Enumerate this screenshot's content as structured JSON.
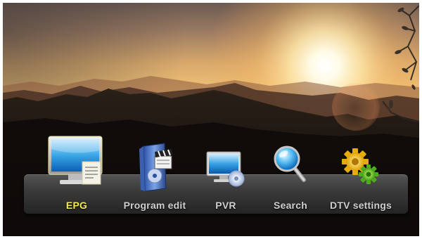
{
  "menu": {
    "selected_index": 0,
    "selected_color": "#f2e94a",
    "label_color": "#cfcfcf",
    "items": [
      {
        "label": "EPG",
        "icon": "tv-monitor-icon",
        "selected": true
      },
      {
        "label": "Program edit",
        "icon": "film-clapper-icon",
        "selected": false
      },
      {
        "label": "PVR",
        "icon": "tv-disc-record-icon",
        "selected": false
      },
      {
        "label": "Search",
        "icon": "magnifier-icon",
        "selected": false
      },
      {
        "label": "DTV settings",
        "icon": "gears-icon",
        "selected": false
      }
    ]
  }
}
